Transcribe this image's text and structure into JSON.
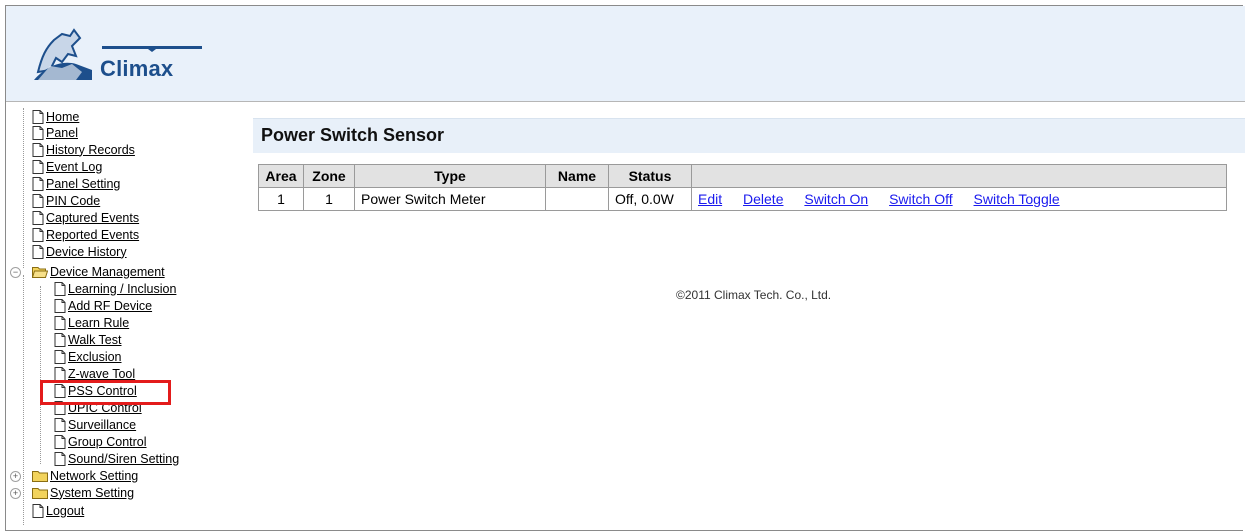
{
  "brand": {
    "logo_text": "Climax"
  },
  "sidebar": {
    "items": [
      {
        "label": "Home"
      },
      {
        "label": "Panel"
      },
      {
        "label": "History Records"
      },
      {
        "label": "Event Log"
      },
      {
        "label": "Panel Setting"
      },
      {
        "label": "PIN Code"
      },
      {
        "label": "Captured Events"
      },
      {
        "label": "Reported Events"
      },
      {
        "label": "Device History"
      },
      {
        "label": "Device Management"
      },
      {
        "label": "Learning / Inclusion"
      },
      {
        "label": "Add RF Device"
      },
      {
        "label": "Learn Rule"
      },
      {
        "label": "Walk Test"
      },
      {
        "label": "Exclusion"
      },
      {
        "label": "Z-wave Tool"
      },
      {
        "label": "PSS Control"
      },
      {
        "label": "UPIC Control"
      },
      {
        "label": "Surveillance"
      },
      {
        "label": "Group Control"
      },
      {
        "label": "Sound/Siren Setting"
      },
      {
        "label": "Network Setting"
      },
      {
        "label": "System Setting"
      },
      {
        "label": "Logout"
      }
    ]
  },
  "main": {
    "title": "Power Switch Sensor",
    "table": {
      "headers": [
        "Area",
        "Zone",
        "Type",
        "Name",
        "Status"
      ],
      "rows": [
        {
          "area": "1",
          "zone": "1",
          "type": "Power Switch Meter",
          "name": "",
          "status": "Off, 0.0W",
          "actions": [
            "Edit",
            "Delete",
            "Switch On",
            "Switch Off",
            "Switch Toggle"
          ]
        }
      ]
    }
  },
  "footer": {
    "copyright": "©2011 Climax Tech. Co., Ltd."
  },
  "colors": {
    "header_bg": "#e9f1fa",
    "link": "#1a1aee",
    "highlight": "#e31b1b"
  }
}
